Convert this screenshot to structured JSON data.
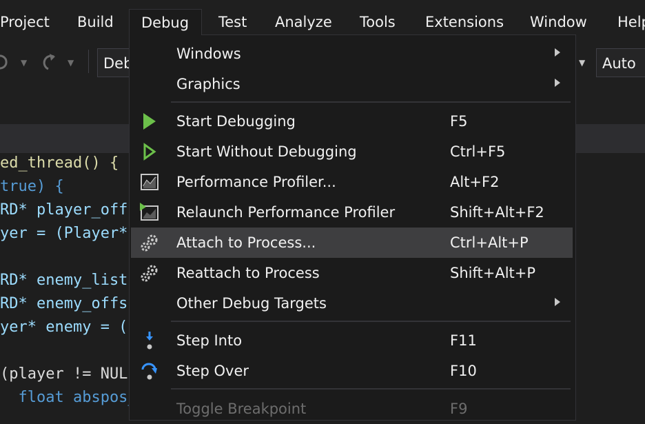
{
  "menubar": {
    "items": [
      "Project",
      "Build",
      "Debug",
      "Test",
      "Analyze",
      "Tools",
      "Extensions",
      "Window",
      "Help"
    ]
  },
  "toolbar": {
    "config_combo": "Debug",
    "platform_combo": "Auto"
  },
  "code": {
    "lines": [
      "ed_thread() {",
      "true) {",
      "RD* player_off",
      "yer = (Player*",
      "",
      "RD* enemy_list",
      "RD* enemy_offs",
      "yer* enemy = (",
      "",
      "(player != NUL",
      "  float abspos_"
    ]
  },
  "debug_menu": {
    "items": [
      {
        "label": "Windows",
        "shortcut": "",
        "submenu": true,
        "icon": ""
      },
      {
        "label": "Graphics",
        "shortcut": "",
        "submenu": true,
        "icon": ""
      },
      {
        "label": "Start Debugging",
        "shortcut": "F5",
        "submenu": false,
        "icon": "play-filled-icon"
      },
      {
        "label": "Start Without Debugging",
        "shortcut": "Ctrl+F5",
        "submenu": false,
        "icon": "play-outline-icon"
      },
      {
        "label": "Performance Profiler...",
        "shortcut": "Alt+F2",
        "submenu": false,
        "icon": "performance-chart-icon"
      },
      {
        "label": "Relaunch Performance Profiler",
        "shortcut": "Shift+Alt+F2",
        "submenu": false,
        "icon": "relaunch-profiler-icon"
      },
      {
        "label": "Attach to Process...",
        "shortcut": "Ctrl+Alt+P",
        "submenu": false,
        "icon": "gears-icon",
        "hover": true
      },
      {
        "label": "Reattach to Process",
        "shortcut": "Shift+Alt+P",
        "submenu": false,
        "icon": "gears-icon"
      },
      {
        "label": "Other Debug Targets",
        "shortcut": "",
        "submenu": true,
        "icon": ""
      },
      {
        "label": "Step Into",
        "shortcut": "F11",
        "submenu": false,
        "icon": "step-into-icon"
      },
      {
        "label": "Step Over",
        "shortcut": "F10",
        "submenu": false,
        "icon": "step-over-icon"
      },
      {
        "label": "Toggle Breakpoint",
        "shortcut": "F9",
        "submenu": false,
        "icon": "",
        "disabled": true
      }
    ]
  },
  "colors": {
    "accent_green": "#6cc04a",
    "step_blue": "#3794ff",
    "hover_bg": "#3e3e40"
  }
}
